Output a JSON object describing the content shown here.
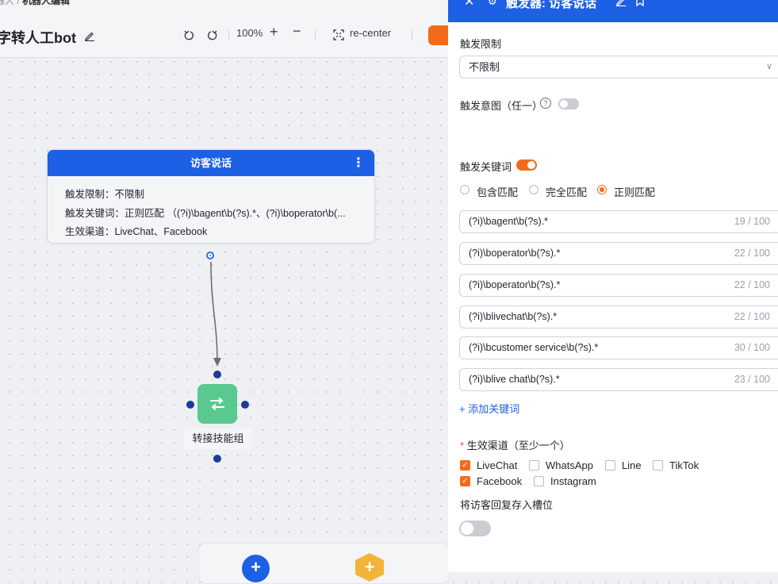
{
  "breadcrumb": {
    "prefix": "器人 /",
    "current": "机器人编辑"
  },
  "bot_title": "字转人工bot",
  "toolbar": {
    "zoom": "100%",
    "recenter_label": "re-center"
  },
  "node_card": {
    "title": "访客说话",
    "lines": [
      "触发限制：不限制",
      "触发关键词：正则匹配 （(?i)\\bagent\\b(?s).*、(?i)\\boperator\\b(...",
      "生效渠道：LiveChat、Facebook"
    ]
  },
  "skill_node": {
    "label": "转接技能组"
  },
  "panel": {
    "title": "触发器: 访客说话",
    "limit_label": "触发限制",
    "limit_value": "不限制",
    "intent_label": "触发意图（任一）",
    "keyword_label": "触发关键词",
    "match_options": [
      "包含匹配",
      "完全匹配",
      "正则匹配"
    ],
    "selected_match": "正则匹配",
    "keywords": [
      {
        "value": "(?i)\\bagent\\b(?s).*",
        "count": "19 / 100"
      },
      {
        "value": "(?i)\\boperator\\b(?s).*",
        "count": "22 / 100"
      },
      {
        "value": "(?i)\\boperator\\b(?s).*",
        "count": "22 / 100"
      },
      {
        "value": "(?i)\\blivechat\\b(?s).*",
        "count": "22 / 100"
      },
      {
        "value": "(?i)\\bcustomer service\\b(?s).*",
        "count": "30 / 100"
      },
      {
        "value": "(?i)\\blive chat\\b(?s).*",
        "count": "23 / 100"
      }
    ],
    "add_keyword": "+ 添加关键词",
    "channels_label": "生效渠道（至少一个）",
    "required_mark": "*",
    "channels": [
      {
        "name": "LiveChat",
        "checked": true
      },
      {
        "name": "WhatsApp",
        "checked": false
      },
      {
        "name": "Line",
        "checked": false
      },
      {
        "name": "TikTok",
        "checked": false
      },
      {
        "name": "Facebook",
        "checked": true
      },
      {
        "name": "Instagram",
        "checked": false
      }
    ],
    "save_reply_label": "将访客回复存入槽位"
  },
  "colors": {
    "accent": "#f26b1d",
    "primary": "#1d5fe5",
    "node_green": "#59c98f"
  },
  "icons": [
    "edit-icon",
    "undo-icon",
    "redo-icon",
    "zoom-in-icon",
    "zoom-out-icon",
    "recenter-icon",
    "more-icon",
    "transfer-icon",
    "help-icon",
    "close-icon",
    "bookmark-icon",
    "chevron-down-icon"
  ]
}
